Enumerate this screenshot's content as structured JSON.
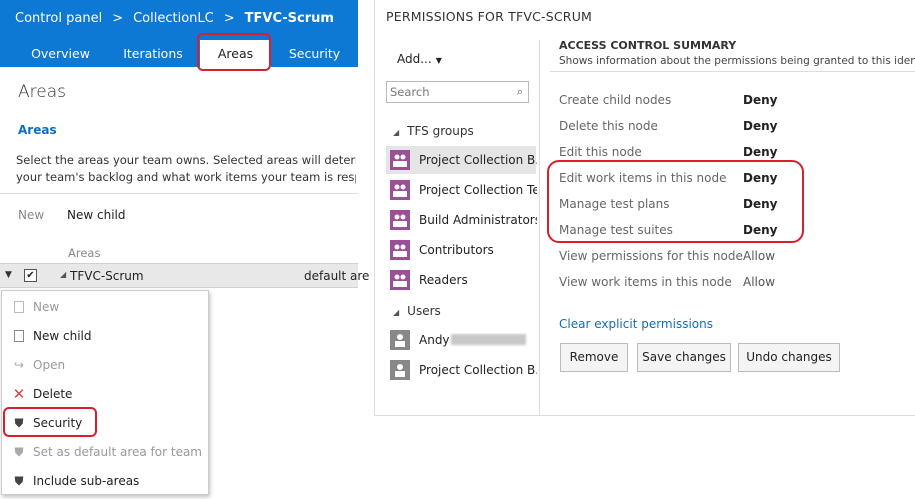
{
  "header": {
    "breadcrumbs": [
      "Control panel",
      "CollectionLC",
      "TFVC-Scrum"
    ],
    "separator": ">",
    "tabs": [
      "Overview",
      "Iterations",
      "Areas",
      "Security"
    ],
    "active_tab": "Areas"
  },
  "areas": {
    "title": "Areas",
    "subheading": "Areas",
    "description_line1": "Select the areas your team owns. Selected areas will determine w",
    "description_line2": "your team's backlog and what work items your team is responsibl",
    "toolbar": {
      "new": "New",
      "new_child": "New child"
    },
    "column_header": "Areas",
    "row": {
      "name": "TFVC-Scrum",
      "default_label": "default are",
      "checked": true
    }
  },
  "context_menu": {
    "items": [
      {
        "label": "New",
        "icon": "document-icon",
        "disabled": true
      },
      {
        "label": "New child",
        "icon": "document-icon",
        "disabled": false
      },
      {
        "label": "Open",
        "icon": "redo-arrow-icon",
        "disabled": true
      },
      {
        "label": "Delete",
        "icon": "delete-x-icon",
        "disabled": false
      },
      {
        "label": "Security",
        "icon": "shield-icon",
        "disabled": false
      },
      {
        "label": "Set as default area for team",
        "icon": "shield-icon",
        "disabled": true
      },
      {
        "label": "Include sub-areas",
        "icon": "shield-icon",
        "disabled": false
      }
    ]
  },
  "permissions": {
    "title": "PERMISSIONS FOR TFVC-SCRUM",
    "add_label": "Add...",
    "search_placeholder": "Search",
    "tfs_groups_label": "TFS groups",
    "groups": [
      "Project Collection B...",
      "Project Collection Te...",
      "Build Administrators",
      "Contributors",
      "Readers"
    ],
    "users_label": "Users",
    "users": [
      "Andy",
      "Project Collection B..."
    ],
    "summary_title": "ACCESS CONTROL SUMMARY",
    "summary_subtitle": "Shows information about the permissions being granted to this identity",
    "entries": [
      {
        "name": "Create child nodes",
        "value": "Deny"
      },
      {
        "name": "Delete this node",
        "value": "Deny"
      },
      {
        "name": "Edit this node",
        "value": "Deny"
      },
      {
        "name": "Edit work items in this node",
        "value": "Deny"
      },
      {
        "name": "Manage test plans",
        "value": "Deny"
      },
      {
        "name": "Manage test suites",
        "value": "Deny"
      },
      {
        "name": "View permissions for this node",
        "value": "Allow"
      },
      {
        "name": "View work items in this node",
        "value": "Allow"
      }
    ],
    "clear_link": "Clear explicit permissions",
    "buttons": {
      "remove": "Remove",
      "save": "Save changes",
      "undo": "Undo changes"
    }
  },
  "colors": {
    "header_blue": "#0e78d5",
    "link_blue": "#106ebe",
    "highlight_red": "#d6202e",
    "group_purple": "#9b4f96"
  }
}
